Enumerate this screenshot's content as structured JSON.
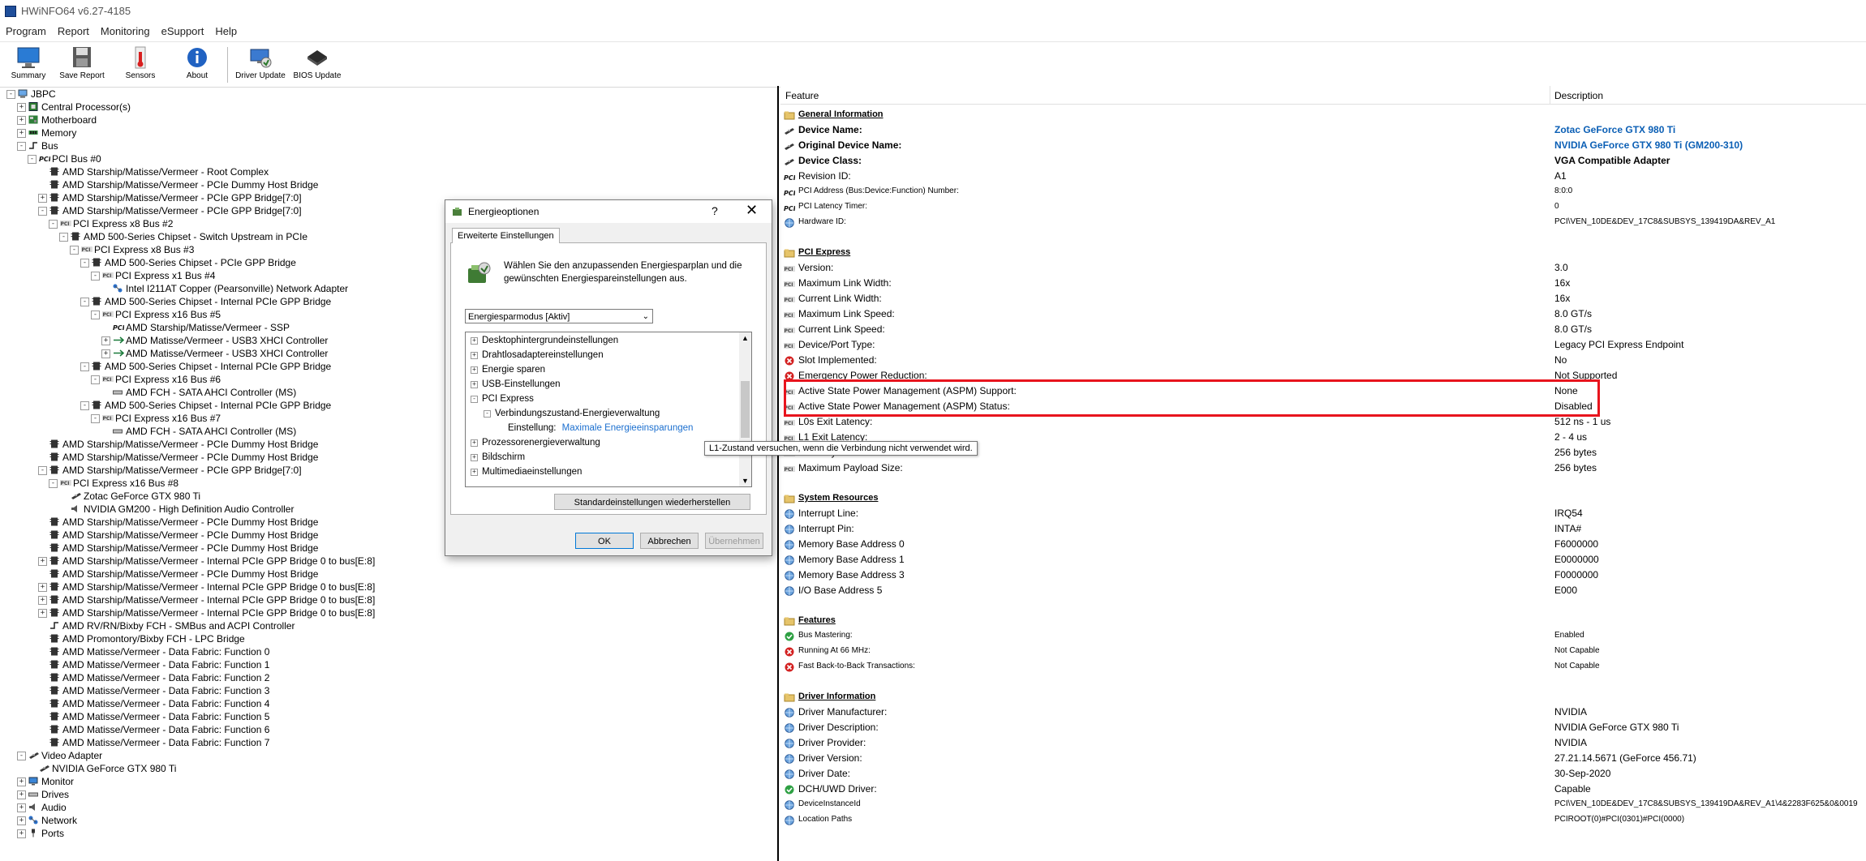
{
  "app": {
    "title": "HWiNFO64 v6.27-4185"
  },
  "menu": [
    "Program",
    "Report",
    "Monitoring",
    "eSupport",
    "Help"
  ],
  "toolbar": [
    {
      "label": "Summary",
      "icon": "monitor-icon"
    },
    {
      "label": "Save Report",
      "icon": "floppy-disk-icon"
    },
    {
      "label": "Sensors",
      "icon": "thermometer-icon"
    },
    {
      "label": "About",
      "icon": "info-icon"
    },
    {
      "label": "Driver Update",
      "icon": "driver-update-icon"
    },
    {
      "label": "BIOS Update",
      "icon": "chip-icon"
    }
  ],
  "tree": [
    {
      "label": "JBPC",
      "exp": "-",
      "icon": "computer"
    },
    {
      "label": "Central Processor(s)",
      "exp": "+",
      "icon": "cpu"
    },
    {
      "label": "Motherboard",
      "exp": "+",
      "icon": "board"
    },
    {
      "label": "Memory",
      "exp": "+",
      "icon": "memory"
    },
    {
      "label": "Bus",
      "exp": "-",
      "icon": "bus"
    },
    {
      "label": "PCI Bus #0",
      "exp": "-",
      "icon": "pci"
    },
    {
      "label": "AMD Starship/Matisse/Vermeer - Root Complex",
      "exp": "",
      "icon": "device"
    },
    {
      "label": "AMD Starship/Matisse/Vermeer - PCIe Dummy Host Bridge",
      "exp": "",
      "icon": "device"
    },
    {
      "label": "AMD Starship/Matisse/Vermeer - PCIe GPP Bridge[7:0]",
      "exp": "+",
      "icon": "device"
    },
    {
      "label": "AMD Starship/Matisse/Vermeer - PCIe GPP Bridge[7:0]",
      "exp": "-",
      "icon": "device"
    },
    {
      "label": "PCI Express x8 Bus #2",
      "exp": "-",
      "icon": "pcie"
    },
    {
      "label": "AMD 500-Series Chipset - Switch Upstream in PCIe",
      "exp": "-",
      "icon": "device"
    },
    {
      "label": "PCI Express x8 Bus #3",
      "exp": "-",
      "icon": "pcie"
    },
    {
      "label": "AMD 500-Series Chipset - PCIe GPP Bridge",
      "exp": "-",
      "icon": "device"
    },
    {
      "label": "PCI Express x1 Bus #4",
      "exp": "-",
      "icon": "pcie"
    },
    {
      "label": "Intel I211AT Copper (Pearsonville) Network Adapter",
      "exp": "",
      "icon": "network"
    },
    {
      "label": "AMD 500-Series Chipset - Internal PCIe GPP Bridge",
      "exp": "-",
      "icon": "device"
    },
    {
      "label": "PCI Express x16 Bus #5",
      "exp": "-",
      "icon": "pcie"
    },
    {
      "label": "AMD Starship/Matisse/Vermeer - SSP",
      "exp": "",
      "icon": "pci"
    },
    {
      "label": "AMD Matisse/Vermeer - USB3 XHCI Controller",
      "exp": "+",
      "icon": "usb"
    },
    {
      "label": "AMD Matisse/Vermeer - USB3 XHCI Controller",
      "exp": "+",
      "icon": "usb"
    },
    {
      "label": "AMD 500-Series Chipset - Internal PCIe GPP Bridge",
      "exp": "-",
      "icon": "device"
    },
    {
      "label": "PCI Express x16 Bus #6",
      "exp": "-",
      "icon": "pcie"
    },
    {
      "label": "AMD FCH - SATA AHCI Controller (MS)",
      "exp": "",
      "icon": "drive"
    },
    {
      "label": "AMD 500-Series Chipset - Internal PCIe GPP Bridge",
      "exp": "-",
      "icon": "device"
    },
    {
      "label": "PCI Express x16 Bus #7",
      "exp": "-",
      "icon": "pcie"
    },
    {
      "label": "AMD FCH - SATA AHCI Controller (MS)",
      "exp": "",
      "icon": "drive"
    },
    {
      "label": "AMD Starship/Matisse/Vermeer - PCIe Dummy Host Bridge",
      "exp": "",
      "icon": "device"
    },
    {
      "label": "AMD Starship/Matisse/Vermeer - PCIe Dummy Host Bridge",
      "exp": "",
      "icon": "device"
    },
    {
      "label": "AMD Starship/Matisse/Vermeer - PCIe GPP Bridge[7:0]",
      "exp": "-",
      "icon": "device"
    },
    {
      "label": "PCI Express x16 Bus #8",
      "exp": "-",
      "icon": "pcie"
    },
    {
      "label": "Zotac GeForce GTX 980 Ti",
      "exp": "",
      "icon": "gpu"
    },
    {
      "label": "NVIDIA GM200 - High Definition Audio Controller",
      "exp": "",
      "icon": "audio"
    },
    {
      "label": "AMD Starship/Matisse/Vermeer - PCIe Dummy Host Bridge",
      "exp": "",
      "icon": "device"
    },
    {
      "label": "AMD Starship/Matisse/Vermeer - PCIe Dummy Host Bridge",
      "exp": "",
      "icon": "device"
    },
    {
      "label": "AMD Starship/Matisse/Vermeer - PCIe Dummy Host Bridge",
      "exp": "",
      "icon": "device"
    },
    {
      "label": "AMD Starship/Matisse/Vermeer - Internal PCIe GPP Bridge 0 to bus[E:8]",
      "exp": "+",
      "icon": "device"
    },
    {
      "label": "AMD Starship/Matisse/Vermeer - PCIe Dummy Host Bridge",
      "exp": "",
      "icon": "device"
    },
    {
      "label": "AMD Starship/Matisse/Vermeer - Internal PCIe GPP Bridge 0 to bus[E:8]",
      "exp": "+",
      "icon": "device"
    },
    {
      "label": "AMD Starship/Matisse/Vermeer - Internal PCIe GPP Bridge 0 to bus[E:8]",
      "exp": "+",
      "icon": "device"
    },
    {
      "label": "AMD Starship/Matisse/Vermeer - Internal PCIe GPP Bridge 0 to bus[E:8]",
      "exp": "+",
      "icon": "device"
    },
    {
      "label": "AMD RV/RN/Bixby FCH - SMBus and ACPI Controller",
      "exp": "",
      "icon": "bus"
    },
    {
      "label": "AMD Promontory/Bixby FCH - LPC Bridge",
      "exp": "",
      "icon": "device"
    },
    {
      "label": "AMD Matisse/Vermeer - Data Fabric: Function 0",
      "exp": "",
      "icon": "device"
    },
    {
      "label": "AMD Matisse/Vermeer - Data Fabric: Function 1",
      "exp": "",
      "icon": "device"
    },
    {
      "label": "AMD Matisse/Vermeer - Data Fabric: Function 2",
      "exp": "",
      "icon": "device"
    },
    {
      "label": "AMD Matisse/Vermeer - Data Fabric: Function 3",
      "exp": "",
      "icon": "device"
    },
    {
      "label": "AMD Matisse/Vermeer - Data Fabric: Function 4",
      "exp": "",
      "icon": "device"
    },
    {
      "label": "AMD Matisse/Vermeer - Data Fabric: Function 5",
      "exp": "",
      "icon": "device"
    },
    {
      "label": "AMD Matisse/Vermeer - Data Fabric: Function 6",
      "exp": "",
      "icon": "device"
    },
    {
      "label": "AMD Matisse/Vermeer - Data Fabric: Function 7",
      "exp": "",
      "icon": "device"
    },
    {
      "label": "Video Adapter",
      "exp": "-",
      "icon": "gpu"
    },
    {
      "label": "NVIDIA GeForce GTX 980 Ti",
      "exp": "",
      "icon": "gpu"
    },
    {
      "label": "Monitor",
      "exp": "+",
      "icon": "monitor"
    },
    {
      "label": "Drives",
      "exp": "+",
      "icon": "drive"
    },
    {
      "label": "Audio",
      "exp": "+",
      "icon": "audio"
    },
    {
      "label": "Network",
      "exp": "+",
      "icon": "network"
    },
    {
      "label": "Ports",
      "exp": "+",
      "icon": "port"
    }
  ],
  "details": {
    "col_feature": "Feature",
    "col_description": "Description",
    "rows": [
      {
        "type": "section",
        "label": "General Information",
        "icon": "folder"
      },
      {
        "label": "Device Name:",
        "value": "Zotac GeForce GTX 980 Ti",
        "icon": "gpu",
        "style": "bold blue"
      },
      {
        "label": "Original Device Name:",
        "value": "NVIDIA GeForce GTX 980 Ti (GM200-310)",
        "icon": "gpu",
        "style": "bold blue"
      },
      {
        "label": "Device Class:",
        "value": "VGA Compatible Adapter",
        "icon": "gpu",
        "style": "bold boldv"
      },
      {
        "label": "Revision ID:",
        "value": "A1",
        "icon": "pci",
        "style": ""
      },
      {
        "label": "PCI Address (Bus:Device:Function) Number:",
        "value": "8:0:0",
        "icon": "pci",
        "style": "small"
      },
      {
        "label": "PCI Latency Timer:",
        "value": "0",
        "icon": "pci",
        "style": "small"
      },
      {
        "label": "Hardware ID:",
        "value": "PCI\\VEN_10DE&DEV_17C8&SUBSYS_139419DA&REV_A1",
        "icon": "globe",
        "style": "small"
      },
      {
        "type": "gap"
      },
      {
        "type": "section",
        "label": "PCI Express",
        "icon": "folder"
      },
      {
        "label": "Version:",
        "value": "3.0",
        "icon": "pcie",
        "style": ""
      },
      {
        "label": "Maximum Link Width:",
        "value": "16x",
        "icon": "pcie",
        "style": ""
      },
      {
        "label": "Current Link Width:",
        "value": "16x",
        "icon": "pcie",
        "style": ""
      },
      {
        "label": "Maximum Link Speed:",
        "value": "8.0 GT/s",
        "icon": "pcie",
        "style": ""
      },
      {
        "label": "Current Link Speed:",
        "value": "8.0 GT/s",
        "icon": "pcie",
        "style": ""
      },
      {
        "label": "Device/Port Type:",
        "value": "Legacy PCI Express Endpoint",
        "icon": "pcie",
        "style": ""
      },
      {
        "label": "Slot Implemented:",
        "value": "No",
        "icon": "x-red",
        "style": ""
      },
      {
        "label": "Emergency Power Reduction:",
        "value": "Not Supported",
        "icon": "x-red",
        "style": ""
      },
      {
        "label": "Active State Power Management (ASPM) Support:",
        "value": "None",
        "icon": "pcie",
        "style": ""
      },
      {
        "label": "Active State Power Management (ASPM) Status:",
        "value": "Disabled",
        "icon": "pcie",
        "style": ""
      },
      {
        "label": "L0s Exit Latency:",
        "value": "512 ns - 1 us",
        "icon": "pcie",
        "style": ""
      },
      {
        "label": "L1 Exit Latency:",
        "value": "2 - 4 us",
        "icon": "pcie",
        "style": ""
      },
      {
        "label": "Max Payload Size:",
        "value": "256 bytes",
        "icon": "pcie",
        "style": ""
      },
      {
        "label": "Maximum Payload Size:",
        "value": "256 bytes",
        "icon": "pcie",
        "style": ""
      },
      {
        "type": "gap"
      },
      {
        "type": "section",
        "label": "System Resources",
        "icon": "folder"
      },
      {
        "label": "Interrupt Line:",
        "value": "IRQ54",
        "icon": "globe",
        "style": ""
      },
      {
        "label": "Interrupt Pin:",
        "value": "INTA#",
        "icon": "globe",
        "style": ""
      },
      {
        "label": "Memory Base Address 0",
        "value": "F6000000",
        "icon": "globe",
        "style": ""
      },
      {
        "label": "Memory Base Address 1",
        "value": "E0000000",
        "icon": "globe",
        "style": ""
      },
      {
        "label": "Memory Base Address 3",
        "value": "F0000000",
        "icon": "globe",
        "style": ""
      },
      {
        "label": "I/O Base Address 5",
        "value": "E000",
        "icon": "globe",
        "style": ""
      },
      {
        "type": "gap"
      },
      {
        "type": "section",
        "label": "Features",
        "icon": "folder"
      },
      {
        "label": "Bus Mastering:",
        "value": "Enabled",
        "icon": "check-green",
        "style": "small"
      },
      {
        "label": "Running At 66 MHz:",
        "value": "Not Capable",
        "icon": "x-red",
        "style": "small"
      },
      {
        "label": "Fast Back-to-Back Transactions:",
        "value": "Not Capable",
        "icon": "x-red",
        "style": "small"
      },
      {
        "type": "gap"
      },
      {
        "type": "section",
        "label": "Driver Information",
        "icon": "folder"
      },
      {
        "label": "Driver Manufacturer:",
        "value": "NVIDIA",
        "icon": "globe",
        "style": ""
      },
      {
        "label": "Driver Description:",
        "value": "NVIDIA GeForce GTX 980 Ti",
        "icon": "globe",
        "style": ""
      },
      {
        "label": "Driver Provider:",
        "value": "NVIDIA",
        "icon": "globe",
        "style": ""
      },
      {
        "label": "Driver Version:",
        "value": "27.21.14.5671 (GeForce 456.71)",
        "icon": "globe",
        "style": ""
      },
      {
        "label": "Driver Date:",
        "value": "30-Sep-2020",
        "icon": "globe",
        "style": ""
      },
      {
        "label": "DCH/UWD Driver:",
        "value": "Capable",
        "icon": "check-green",
        "style": ""
      },
      {
        "label": "DeviceInstanceId",
        "value": "PCI\\VEN_10DE&DEV_17C8&SUBSYS_139419DA&REV_A1\\4&2283F625&0&0019",
        "icon": "globe",
        "style": "small"
      },
      {
        "label": "Location Paths",
        "value": "PCIROOT(0)#PCI(0301)#PCI(0000)",
        "icon": "globe",
        "style": "small"
      }
    ]
  },
  "dialog": {
    "title": "Energieoptionen",
    "help": "?",
    "close": "✕",
    "tab": "Erweiterte Einstellungen",
    "description": "Wählen Sie den anzupassenden Energiesparplan und die gewünschten Energiespareinstellungen aus.",
    "plan_selected": "Energiesparmodus [Aktiv]",
    "tree": [
      {
        "label": "Desktophintergrundeinstellungen",
        "exp": "+",
        "indent": 0
      },
      {
        "label": "Drahtlosadaptereinstellungen",
        "exp": "+",
        "indent": 0
      },
      {
        "label": "Energie sparen",
        "exp": "+",
        "indent": 0
      },
      {
        "label": "USB-Einstellungen",
        "exp": "+",
        "indent": 0
      },
      {
        "label": "PCI Express",
        "exp": "-",
        "indent": 0
      },
      {
        "label": "Verbindungszustand-Energieverwaltung",
        "exp": "-",
        "indent": 1
      },
      {
        "label": "Einstellung:",
        "exp": "",
        "indent": 2,
        "value": "Maximale Energieeinsparungen"
      },
      {
        "label": "Prozessorenergieverwaltung",
        "exp": "+",
        "indent": 0
      },
      {
        "label": "Bildschirm",
        "exp": "+",
        "indent": 0
      },
      {
        "label": "Multimediaeinstellungen",
        "exp": "+",
        "indent": 0
      }
    ],
    "restore_defaults": "Standardeinstellungen wiederherstellen",
    "ok": "OK",
    "cancel": "Abbrechen",
    "apply": "Übernehmen"
  },
  "tooltip": "L1-Zustand versuchen, wenn die Verbindung nicht verwendet wird.",
  "colors": {
    "highlight_box": "#e8141d",
    "value_blue": "#0b5fb5",
    "link_blue": "#1b6fcf"
  }
}
